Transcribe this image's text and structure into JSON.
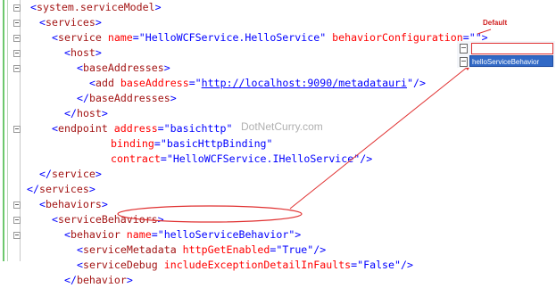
{
  "editor": {
    "lines": [
      [
        [
          "pun",
          "<"
        ],
        [
          "tag",
          "system.serviceModel"
        ],
        [
          "pun",
          ">"
        ]
      ],
      [
        [
          "pun",
          "<"
        ],
        [
          "tag",
          "services"
        ],
        [
          "pun",
          ">"
        ]
      ],
      [
        [
          "pun",
          "<"
        ],
        [
          "tag",
          "service"
        ],
        [
          "attr",
          " name"
        ],
        [
          "pun",
          "=\""
        ],
        [
          "val",
          "HelloWCFService.HelloService"
        ],
        [
          "pun",
          "\""
        ],
        [
          "attr",
          " behaviorConfiguration"
        ],
        [
          "pun",
          "=\"\">"
        ]
      ],
      [
        [
          "pun",
          "<"
        ],
        [
          "tag",
          "host"
        ],
        [
          "pun",
          ">"
        ]
      ],
      [
        [
          "pun",
          "<"
        ],
        [
          "tag",
          "baseAddresses"
        ],
        [
          "pun",
          ">"
        ]
      ],
      [
        [
          "pun",
          "<"
        ],
        [
          "tag",
          "add"
        ],
        [
          "attr",
          " baseAddress"
        ],
        [
          "pun",
          "=\""
        ],
        [
          "url",
          "http://localhost:9090/metadatauri"
        ],
        [
          "pun",
          "\"/>"
        ]
      ],
      [
        [
          "pun",
          "</"
        ],
        [
          "tag",
          "baseAddresses"
        ],
        [
          "pun",
          ">"
        ]
      ],
      [
        [
          "pun",
          "</"
        ],
        [
          "tag",
          "host"
        ],
        [
          "pun",
          ">"
        ]
      ],
      [
        [
          "pun",
          "<"
        ],
        [
          "tag",
          "endpoint"
        ],
        [
          "attr",
          " address"
        ],
        [
          "pun",
          "=\""
        ],
        [
          "val",
          "basichttp"
        ],
        [
          "pun",
          "\""
        ]
      ],
      [
        [
          "attr",
          "binding"
        ],
        [
          "pun",
          "=\""
        ],
        [
          "val",
          "basicHttpBinding"
        ],
        [
          "pun",
          "\""
        ]
      ],
      [
        [
          "attr",
          "contract"
        ],
        [
          "pun",
          "=\""
        ],
        [
          "val",
          "HelloWCFService.IHelloService"
        ],
        [
          "pun",
          "\"/>"
        ]
      ],
      [
        [
          "pun",
          "</"
        ],
        [
          "tag",
          "service"
        ],
        [
          "pun",
          ">"
        ]
      ],
      [
        [
          "pun",
          "</"
        ],
        [
          "tag",
          "services"
        ],
        [
          "pun",
          ">"
        ]
      ],
      [
        [
          "pun",
          "<"
        ],
        [
          "tag",
          "behaviors"
        ],
        [
          "pun",
          ">"
        ]
      ],
      [
        [
          "pun",
          "<"
        ],
        [
          "tag",
          "serviceBehaviors"
        ],
        [
          "pun",
          ">"
        ]
      ],
      [
        [
          "pun",
          "<"
        ],
        [
          "tag",
          "behavior"
        ],
        [
          "attr",
          " name"
        ],
        [
          "pun",
          "=\""
        ],
        [
          "val",
          "helloServiceBehavior"
        ],
        [
          "pun",
          "\">"
        ]
      ],
      [
        [
          "pun",
          "<"
        ],
        [
          "tag",
          "serviceMetadata"
        ],
        [
          "attr",
          " httpGetEnabled"
        ],
        [
          "pun",
          "=\""
        ],
        [
          "val",
          "True"
        ],
        [
          "pun",
          "\"/>"
        ]
      ],
      [
        [
          "pun",
          "<"
        ],
        [
          "tag",
          "serviceDebug"
        ],
        [
          "attr",
          " includeExceptionDetailInFaults"
        ],
        [
          "pun",
          "=\""
        ],
        [
          "val",
          "False"
        ],
        [
          "pun",
          "\"/>"
        ]
      ],
      [
        [
          "pun",
          "</"
        ],
        [
          "tag",
          "behavior"
        ],
        [
          "pun",
          ">"
        ]
      ]
    ]
  },
  "intellisense": {
    "default_label": "Default",
    "items": [
      "",
      "helloServiceBehavior"
    ],
    "selected_index": 1
  },
  "watermark": "DotNetCurry.com",
  "annotation_color": "#e03030"
}
